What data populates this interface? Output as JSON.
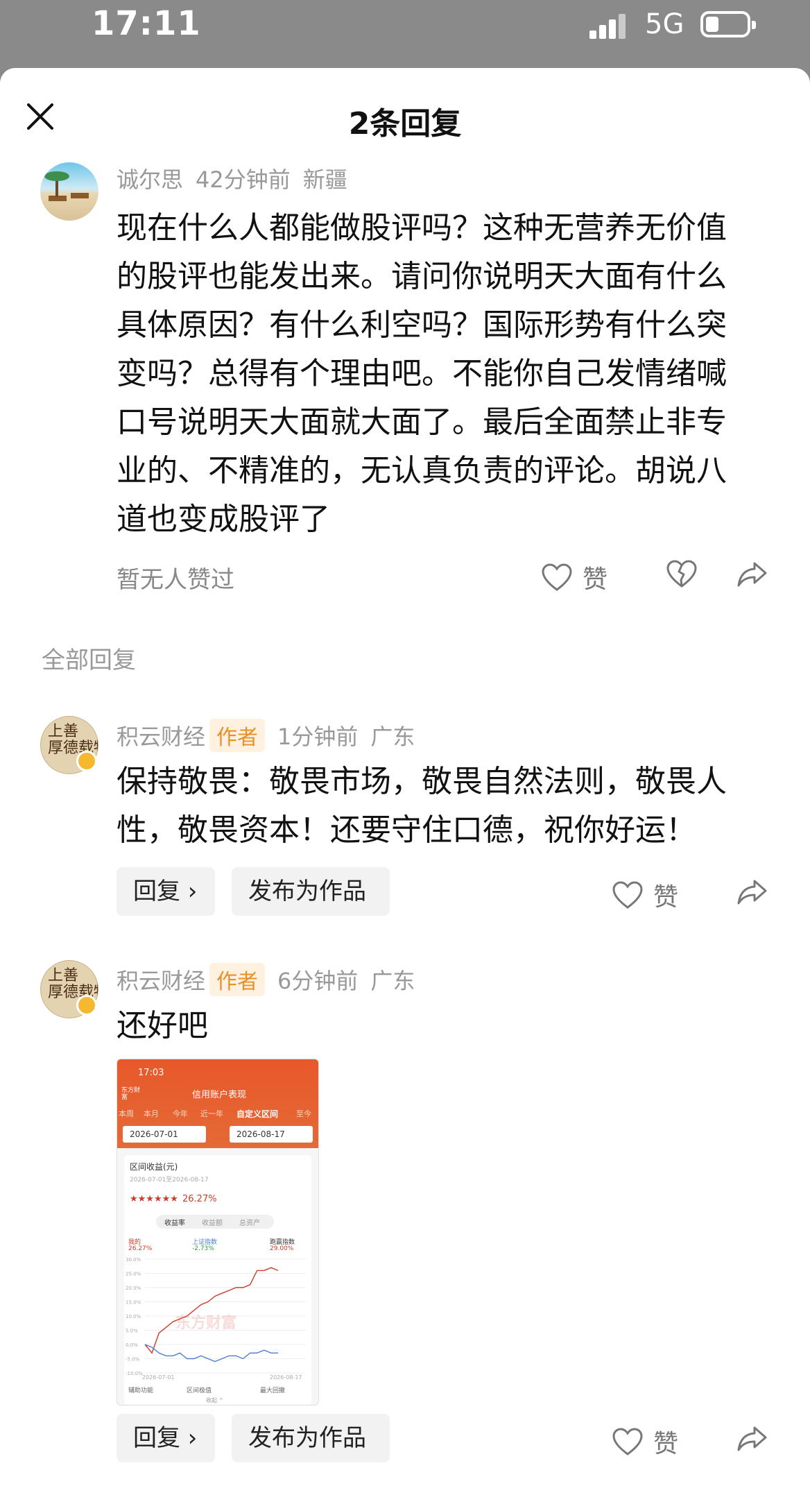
{
  "status": {
    "time": "17:11",
    "network": "5G"
  },
  "header": {
    "title": "2条回复"
  },
  "comment": {
    "user": "诚尔思",
    "time": "42分钟前",
    "location": "新疆",
    "text": "现在什么人都能做股评吗？这种无营养无价值的股评也能发出来。请问你说明天大面有什么具体原因？有什么利空吗？国际形势有什么突变吗？总得有个理由吧。不能你自己发情绪喊口号说明天大面就大面了。最后全面禁止非专业的、不精准的，无认真负责的评论。胡说八道也变成股评了",
    "likes_text": "暂无人赞过",
    "like_label": "赞"
  },
  "section_title": "全部回复",
  "replies": [
    {
      "user": "积云财经",
      "tag": "作者",
      "time": "1分钟前",
      "location": "广东",
      "text": "保持敬畏：敬畏市场，敬畏自然法则，敬畏人性，敬畏资本！还要守住口德，祝你好运！",
      "reply_label": "回复 ›",
      "publish_label": "发布为作品",
      "like_label": "赞"
    },
    {
      "user": "积云财经",
      "tag": "作者",
      "time": "6分钟前",
      "location": "广东",
      "text": "还好吧",
      "reply_label": "回复 ›",
      "publish_label": "发布为作品",
      "like_label": "赞"
    }
  ],
  "avatar_text": "上善\n厚德载物",
  "embedded_screenshot": {
    "time": "17:03",
    "title": "信用账户表现",
    "back": "东方财富",
    "tabs": [
      "本周",
      "本月",
      "今年",
      "近一年",
      "自定义区间",
      "至今"
    ],
    "date_from": "2026-07-01",
    "date_to": "2026-08-17",
    "card_title": "区间收益(元)",
    "card_sub": "2026-07-01至2026-08-17",
    "return_text": "26.27%",
    "segments": [
      "收益率",
      "收益额",
      "总资产"
    ],
    "legend": [
      {
        "name": "我的",
        "value": "26.27%"
      },
      {
        "name": "上证指数",
        "value": "-2.73%"
      },
      {
        "name": "跑赢指数",
        "value": "29.00%"
      }
    ],
    "y_ticks": [
      "30.0%",
      "25.0%",
      "20.0%",
      "15.0%",
      "10.0%",
      "5.0%",
      "0.0%",
      "-5.0%",
      "-10.0%"
    ],
    "x_start": "2026-07-01",
    "x_end": "2026-08-17",
    "watermark": "东方财富",
    "footer_left": "辅助功能",
    "footer_mid": "区间极值",
    "footer_right": "最大回撤",
    "collapse": "收起 ^",
    "colors": {
      "mine": "#d03a2a",
      "index": "#4a7fd0"
    }
  }
}
